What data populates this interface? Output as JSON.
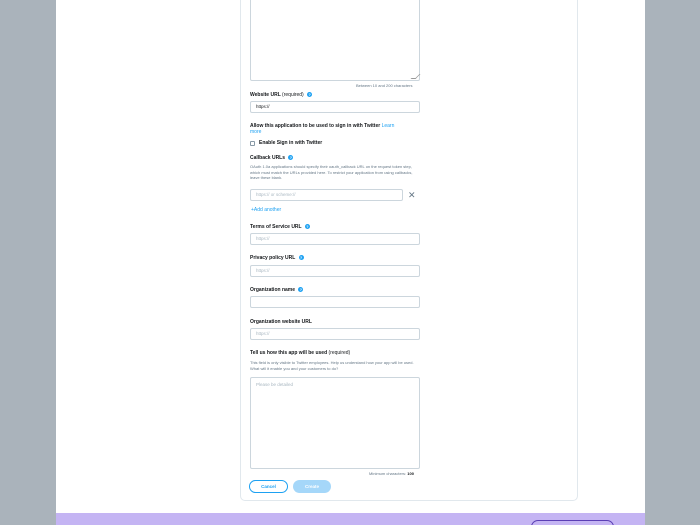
{
  "form": {
    "description_hint": "Between 10 and 200 characters",
    "website": {
      "label": "Website URL",
      "required": "(required)",
      "value": "https://"
    },
    "signin": {
      "label": "Allow this application to be used to sign in with Twitter",
      "learn_more": "Learn more",
      "checkbox_label": "Enable Sign in with Twitter"
    },
    "callback": {
      "label": "Callback URLs",
      "description": "OAuth 1.0a applications should specify their oauth_callback URL on the request token step, which must match the URLs provided here. To restrict your application from using callbacks, leave these blank.",
      "placeholder": "https:// or scheme://",
      "add_another": "+Add another"
    },
    "terms": {
      "label": "Terms of Service URL",
      "placeholder": "https://"
    },
    "privacy": {
      "label": "Privacy policy URL",
      "placeholder": "https://"
    },
    "org_name": {
      "label": "Organization name",
      "value": ""
    },
    "org_website": {
      "label": "Organization website URL",
      "placeholder": "https://"
    },
    "usage": {
      "label": "Tell us how this app will be used",
      "required": "(required)",
      "description": "This field is only visible to Twitter employees. Help us understand how your app will be used. What will it enable you and your customers to do?",
      "placeholder": "Please be detailed",
      "min_label": "Minimum characters:",
      "min_value": "100"
    },
    "buttons": {
      "cancel": "Cancel",
      "create": "Create"
    }
  },
  "icons": {
    "help": "help-icon",
    "remove": "close-icon"
  },
  "colors": {
    "accent": "#1da1f2",
    "create_disabled": "#a5d7f9",
    "background": "#aab3bb",
    "footer": "#c4b4f3"
  }
}
